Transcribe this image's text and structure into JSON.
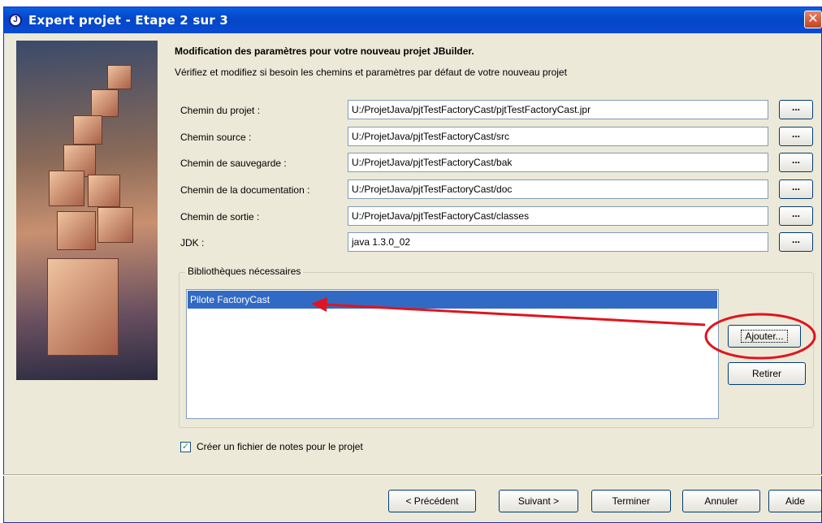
{
  "window": {
    "title": "Expert projet - Etape 2 sur 3",
    "title_icon": "J",
    "close_glyph": "✕"
  },
  "header": {
    "heading": "Modification des paramètres pour votre nouveau projet JBuilder.",
    "subheading": "Vérifiez et modifiez si besoin les chemins et paramètres par défaut de votre nouveau projet"
  },
  "fields": [
    {
      "label": "Chemin du projet :",
      "value": "U:/ProjetJava/pjtTestFactoryCast/pjtTestFactoryCast.jpr"
    },
    {
      "label": "Chemin source :",
      "value": "U:/ProjetJava/pjtTestFactoryCast/src"
    },
    {
      "label": "Chemin de sauvegarde :",
      "value": "U:/ProjetJava/pjtTestFactoryCast/bak"
    },
    {
      "label": "Chemin de la documentation :",
      "value": "U:/ProjetJava/pjtTestFactoryCast/doc"
    },
    {
      "label": "Chemin de sortie :",
      "value": "U:/ProjetJava/pjtTestFactoryCast/classes"
    },
    {
      "label": "JDK :",
      "value": "java 1.3.0_02"
    }
  ],
  "browse_label": "...",
  "libraries": {
    "title": "Bibliothèques nécessaires",
    "items": [
      "Pilote FactoryCast"
    ],
    "add_label": "Ajouter...",
    "remove_label": "Retirer"
  },
  "notes": {
    "checked": true,
    "check_glyph": "✓",
    "label": "Créer un fichier de notes pour le projet"
  },
  "footer": {
    "prev_label": "< Précédent",
    "next_label": "Suivant >",
    "finish_label": "Terminer",
    "cancel_label": "Annuler",
    "help_label": "Aide"
  },
  "colors": {
    "annotation": "#e0141e",
    "selection": "#316ac5",
    "titlebar": "#0446c8"
  }
}
